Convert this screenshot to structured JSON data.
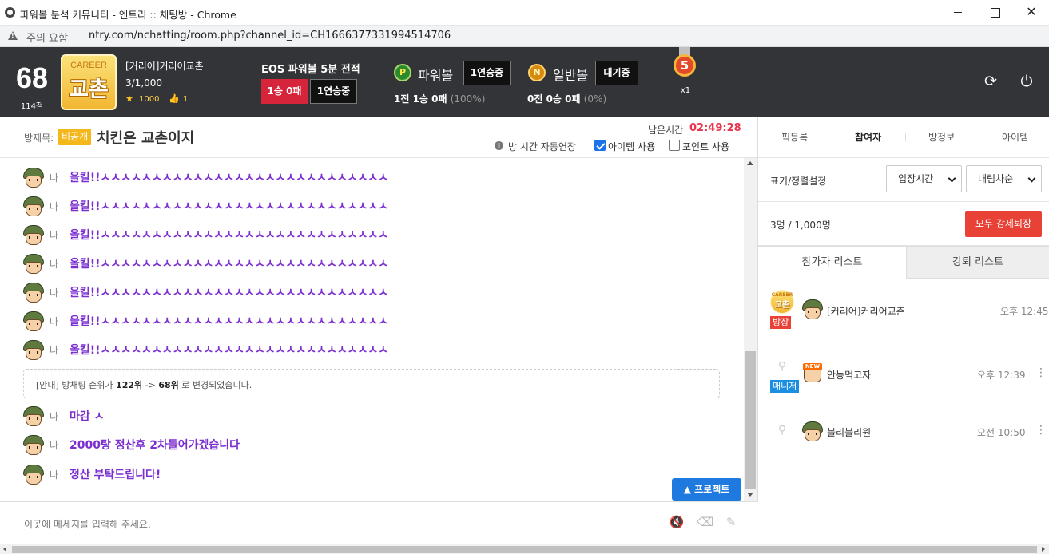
{
  "window": {
    "title": "파워볼 분석 커뮤니티 - 엔트리 :: 채팅방 - Chrome"
  },
  "address": {
    "warning": "주의 요함",
    "url": "ntry.com/nchatting/room.php?channel_id=CH1666377331994514706"
  },
  "header": {
    "rank": "68",
    "points": "114점",
    "badge_top": "CAREER",
    "badge_main": "교촌",
    "room_name": "[커리어]커리어교촌",
    "capacity": "3/1,000",
    "stars": "1000",
    "likes": "1",
    "eos_title": "EOS 파워볼 5분 전적",
    "eos_record": "1승 0패",
    "eos_streak": "1연승중",
    "powerball": {
      "icon_letter": "P",
      "label": "파워볼",
      "status": "1연승중",
      "record": "1전 1승 0패",
      "pct": "(100%)"
    },
    "normalball": {
      "icon_letter": "N",
      "label": "일반볼",
      "status": "대기중",
      "record": "0전 0승 0패",
      "pct": "(0%)"
    },
    "medal": {
      "number": "5",
      "count": "x1"
    },
    "icons": [
      "refresh-icon",
      "power-icon"
    ]
  },
  "room": {
    "label": "방제목:",
    "privacy": "비공개",
    "title": "치킨은 교촌이지",
    "remain_label": "남은시간",
    "remain_time": "02:49:28",
    "auto_extend": "방 시간 자동연장",
    "item_use": "아이템 사용",
    "item_checked": true,
    "point_use": "포인트 사용",
    "point_checked": false
  },
  "right_tabs": [
    "픽등록",
    "참여자",
    "방정보",
    "아이템"
  ],
  "chat": {
    "me_label": "나",
    "messages": [
      "올킬!!ㅅㅅㅅㅅㅅㅅㅅㅅㅅㅅㅅㅅㅅㅅㅅㅅㅅㅅㅅㅅㅅㅅㅅㅅㅅㅅㅅㅅ",
      "올킬!!ㅅㅅㅅㅅㅅㅅㅅㅅㅅㅅㅅㅅㅅㅅㅅㅅㅅㅅㅅㅅㅅㅅㅅㅅㅅㅅㅅㅅ",
      "올킬!!ㅅㅅㅅㅅㅅㅅㅅㅅㅅㅅㅅㅅㅅㅅㅅㅅㅅㅅㅅㅅㅅㅅㅅㅅㅅㅅㅅㅅ",
      "올킬!!ㅅㅅㅅㅅㅅㅅㅅㅅㅅㅅㅅㅅㅅㅅㅅㅅㅅㅅㅅㅅㅅㅅㅅㅅㅅㅅㅅㅅ",
      "올킬!!ㅅㅅㅅㅅㅅㅅㅅㅅㅅㅅㅅㅅㅅㅅㅅㅅㅅㅅㅅㅅㅅㅅㅅㅅㅅㅅㅅㅅ",
      "올킬!!ㅅㅅㅅㅅㅅㅅㅅㅅㅅㅅㅅㅅㅅㅅㅅㅅㅅㅅㅅㅅㅅㅅㅅㅅㅅㅅㅅㅅ",
      "올킬!!ㅅㅅㅅㅅㅅㅅㅅㅅㅅㅅㅅㅅㅅㅅㅅㅅㅅㅅㅅㅅㅅㅅㅅㅅㅅㅅㅅㅅ",
      "마감 ㅅ",
      "2000탕 정산후 2차들어가겠습니다",
      "정산 부탁드립니다!"
    ],
    "notice": {
      "prefix": "[안내] 방채팅 순위가 ",
      "from": "122위",
      "arrow": " -> ",
      "to": "68위",
      "suffix": " 로 변경되었습니다."
    },
    "protect_label": "▲ 프로젝트",
    "input_placeholder": "이곳에 메세지를 입력해 주세요.",
    "input_icons": [
      "mute-icon",
      "eraser-icon",
      "magic-wand-icon"
    ]
  },
  "panel": {
    "sort_label": "표기/정렬설정",
    "sort_by": "입장시간",
    "sort_order": "내림차순",
    "member_count": "3명 / 1,000명",
    "kick_all": "모두 강제퇴장",
    "tab_participants": "참가자 리스트",
    "tab_kicked": "강퇴 리스트",
    "participants": [
      {
        "name": "[커리어]커리어교촌",
        "time": "오후 12:45",
        "tag": "방장"
      },
      {
        "name": "안농먹고자",
        "time": "오후 12:39",
        "tag": "매니저"
      },
      {
        "name": "블리블리원",
        "time": "오전 10:50",
        "tag": ""
      }
    ],
    "level_badge_top": "CAREER",
    "level_badge_main": "교촌",
    "new_tag": "NEW"
  }
}
